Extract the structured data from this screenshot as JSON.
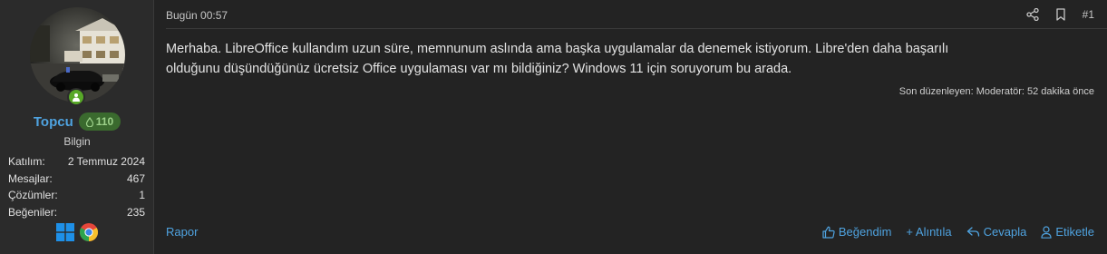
{
  "user": {
    "username": "Topcu",
    "reputation": "110",
    "title": "Bilgin",
    "stats": [
      {
        "label": "Katılım:",
        "value": "2 Temmuz 2024"
      },
      {
        "label": "Mesajlar:",
        "value": "467"
      },
      {
        "label": "Çözümler:",
        "value": "1"
      },
      {
        "label": "Beğeniler:",
        "value": "235"
      }
    ],
    "os_icons": [
      "windows-icon",
      "chrome-icon"
    ],
    "online_status_color": "#58a828"
  },
  "post": {
    "date": "Bugün 00:57",
    "number": "#1",
    "body_line1": "Merhaba. LibreOffice kullandım uzun süre, memnunum aslında ama başka uygulamalar da denemek istiyorum. Libre'den daha başarılı",
    "body_line2": "olduğunu düşündüğünüz ücretsiz Office uygulaması var mı bildiğiniz? Windows 11 için soruyorum bu arada.",
    "edited_note": "Son düzenleyen: Moderatör: 52 dakika önce"
  },
  "footer": {
    "report": "Rapor",
    "like": "Beğendim",
    "quote": "+ Alıntıla",
    "reply": "Cevapla",
    "tag": "Etiketle"
  },
  "colors": {
    "link": "#4fa3e0",
    "background": "#232323",
    "sidebar": "#2b2b2b",
    "reputation_badge": "#3a6a2e"
  }
}
